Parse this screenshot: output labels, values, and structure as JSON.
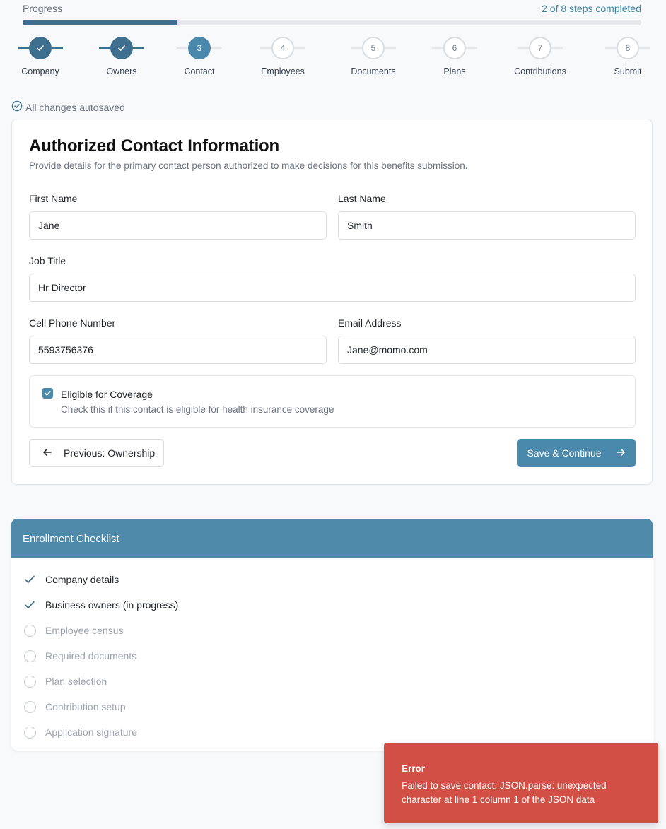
{
  "progress": {
    "label": "Progress",
    "count_text": "2 of 8 steps completed",
    "fraction": 0.25
  },
  "steps": [
    {
      "number": "1",
      "label": "Company",
      "status": "done"
    },
    {
      "number": "2",
      "label": "Owners",
      "status": "done"
    },
    {
      "number": "3",
      "label": "Contact",
      "status": "current"
    },
    {
      "number": "4",
      "label": "Employees",
      "status": "todo"
    },
    {
      "number": "5",
      "label": "Documents",
      "status": "todo"
    },
    {
      "number": "6",
      "label": "Plans",
      "status": "todo"
    },
    {
      "number": "7",
      "label": "Contributions",
      "status": "todo"
    },
    {
      "number": "8",
      "label": "Submit",
      "status": "todo"
    }
  ],
  "autosave": {
    "text": "All changes autosaved",
    "icon": "check-circle-icon"
  },
  "form": {
    "title": "Authorized Contact Information",
    "subtitle": "Provide details for the primary contact person authorized to make decisions for this benefits submission.",
    "first_name": {
      "label": "First Name",
      "value": "Jane"
    },
    "last_name": {
      "label": "Last Name",
      "value": "Smith"
    },
    "job_title": {
      "label": "Job Title",
      "value": "Hr Director"
    },
    "phone": {
      "label": "Cell Phone Number",
      "value": "5593756376"
    },
    "email": {
      "label": "Email Address",
      "value": "Jane@momo.com"
    },
    "coverage": {
      "label": "Eligible for Coverage",
      "description": "Check this if this contact is eligible for health insurance coverage",
      "checked": true
    },
    "prev_button": "Previous: Ownership",
    "save_button": "Save & Continue"
  },
  "checklist": {
    "title": "Enrollment Checklist",
    "items": [
      {
        "label": "Company details",
        "done": true
      },
      {
        "label": "Business owners (in progress)",
        "done": true
      },
      {
        "label": "Employee census",
        "done": false
      },
      {
        "label": "Required documents",
        "done": false
      },
      {
        "label": "Plan selection",
        "done": false
      },
      {
        "label": "Contribution setup",
        "done": false
      },
      {
        "label": "Application signature",
        "done": false
      }
    ]
  },
  "toast": {
    "title": "Error",
    "message": "Failed to save contact: JSON.parse: unexpected character at line 1 column 1 of the JSON data"
  },
  "colors": {
    "primary": "#4a89ab",
    "primary_dark": "#3e6f8e",
    "error": "#d24f46"
  }
}
